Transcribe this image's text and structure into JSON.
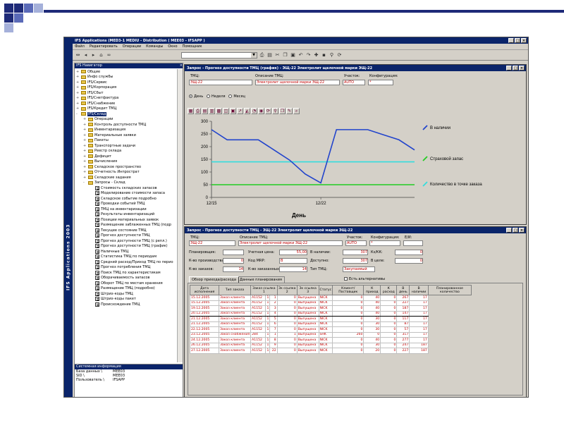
{
  "app": {
    "title": "IFS Applications (MED3-1 MEDIU - Distribution ( MEE03 - IFSAPP )",
    "brand": "IFS Applications 2003",
    "menu": [
      "Файл",
      "Редактировать",
      "Операции",
      "Команды",
      "Окно",
      "Помощник"
    ]
  },
  "navigator": {
    "title": "IFS Навигатор",
    "items": [
      {
        "label": "Общие",
        "level": 0,
        "type": "folder",
        "pm": "+"
      },
      {
        "label": "Инфо службы",
        "level": 0,
        "type": "folder",
        "pm": "+"
      },
      {
        "label": "IFS/Сервис",
        "level": 0,
        "type": "folder",
        "pm": "+"
      },
      {
        "label": "IFS/Корпорация",
        "level": 0,
        "type": "folder",
        "pm": "+"
      },
      {
        "label": "IFS/Сбыт",
        "level": 0,
        "type": "folder",
        "pm": "+"
      },
      {
        "label": "IFS/Снетфактура",
        "level": 0,
        "type": "folder",
        "pm": "+"
      },
      {
        "label": "IFS/Снабжение",
        "level": 0,
        "type": "folder",
        "pm": "+"
      },
      {
        "label": "IFS/Кредит ТМЦ",
        "level": 0,
        "type": "folder",
        "pm": "+"
      },
      {
        "label": "IFS/Склад",
        "level": 0,
        "type": "folder",
        "pm": "-",
        "selected": true
      },
      {
        "label": "Операции",
        "level": 1,
        "type": "folder",
        "pm": "+"
      },
      {
        "label": "Контроль доступности ТМЦ",
        "level": 1,
        "type": "folder",
        "pm": "+"
      },
      {
        "label": "Инвентаризация",
        "level": 1,
        "type": "folder",
        "pm": "+"
      },
      {
        "label": "Материальные заявки",
        "level": 1,
        "type": "folder",
        "pm": "+"
      },
      {
        "label": "Пакеты",
        "level": 1,
        "type": "folder",
        "pm": "+"
      },
      {
        "label": "Транспортные задачи",
        "level": 1,
        "type": "folder",
        "pm": "+"
      },
      {
        "label": "Реестр склада",
        "level": 1,
        "type": "folder",
        "pm": "+"
      },
      {
        "label": "Дефицит",
        "level": 1,
        "type": "folder",
        "pm": "+"
      },
      {
        "label": "Вычисления",
        "level": 1,
        "type": "folder",
        "pm": "+"
      },
      {
        "label": "Складское пространство",
        "level": 1,
        "type": "folder",
        "pm": "+"
      },
      {
        "label": "Отчетность Инпрострат",
        "level": 1,
        "type": "folder",
        "pm": "+"
      },
      {
        "label": "Складские задания",
        "level": 1,
        "type": "folder",
        "pm": "+"
      },
      {
        "label": "Запросы - Склад",
        "level": 1,
        "type": "folder",
        "pm": "-"
      },
      {
        "label": "Стоимость складских запасов",
        "level": 2,
        "type": "doc"
      },
      {
        "label": "Моделирование стоимости запаса",
        "level": 2,
        "type": "doc"
      },
      {
        "label": "Складское событие подробно",
        "level": 2,
        "type": "doc"
      },
      {
        "label": "Проводки событий ТМЦ",
        "level": 2,
        "type": "doc"
      },
      {
        "label": "ТМЦ на инвентаризации",
        "level": 2,
        "type": "doc"
      },
      {
        "label": "Результаты инвентаризаций",
        "level": 2,
        "type": "doc"
      },
      {
        "label": "Позиции материальных заявок",
        "level": 2,
        "type": "doc"
      },
      {
        "label": "Размещение заблаженных ТМЦ (подр",
        "level": 2,
        "type": "doc"
      },
      {
        "label": "Текущее состояние ТМЦ",
        "level": 2,
        "type": "doc"
      },
      {
        "label": "Прогноз доступности ТМЦ",
        "level": 2,
        "type": "doc"
      },
      {
        "label": "Прогноз доступности ТМЦ (с репл.)",
        "level": 2,
        "type": "doc"
      },
      {
        "label": "Прогноз доступности ТМЦ (график)",
        "level": 2,
        "type": "doc"
      },
      {
        "label": "Наличные ТМЦ",
        "level": 2,
        "type": "doc"
      },
      {
        "label": "Статистика ТМЦ по периодам",
        "level": 2,
        "type": "doc"
      },
      {
        "label": "Средний расход/Приход ТМЦ по перио",
        "level": 2,
        "type": "doc"
      },
      {
        "label": "Прогноз потребления ТМЦ",
        "level": 2,
        "type": "doc"
      },
      {
        "label": "Поиск ТМЦ по характеристикам",
        "level": 2,
        "type": "doc"
      },
      {
        "label": "Оборачиваемость запасов",
        "level": 2,
        "type": "doc"
      },
      {
        "label": "Оборот ТМЦ по местам хранения",
        "level": 2,
        "type": "doc"
      },
      {
        "label": "Размещение ТМЦ (подробно)",
        "level": 2,
        "type": "doc"
      },
      {
        "label": "Штрих-коды ТМЦ",
        "level": 2,
        "type": "doc"
      },
      {
        "label": "Штрих-коды пакет",
        "level": 2,
        "type": "doc"
      },
      {
        "label": "Происхождение ТМЦ",
        "level": 2,
        "type": "doc"
      }
    ],
    "info": {
      "title": "Системная информация",
      "rows": [
        {
          "k": "База данных \\",
          "v": "MEE03"
        },
        {
          "k": "SID \\",
          "v": "MEE03"
        },
        {
          "k": "Пользователь \\",
          "v": "IFSAPP"
        }
      ]
    }
  },
  "graph_window": {
    "title": "Запрос - Прогноз доступности ТМЦ (график) - ЭЩ-22 Электролит щелочной марки ЭЩ-22",
    "labels": {
      "tmc": "ТМЦ:",
      "desc": "Описание ТМЦ:",
      "site": "Участок:",
      "config": "Конфигурация:"
    },
    "values": {
      "tmc": "ЭЩ-22",
      "desc": "Электролит щелочной марки ЭЩ-22",
      "site": "AUTO",
      "config": "*"
    },
    "radios": [
      {
        "label": "День",
        "checked": true
      },
      {
        "label": "Неделя",
        "checked": false
      },
      {
        "label": "Месяц",
        "checked": false
      }
    ]
  },
  "chart_data": {
    "type": "line",
    "x": [
      "12/15",
      "12/16",
      "12/17",
      "12/18",
      "12/19",
      "12/20",
      "12/21",
      "12/22",
      "12/23",
      "12/24",
      "12/25",
      "12/26",
      "12/27"
    ],
    "tick_labels": [
      "12/15",
      "12/22"
    ],
    "xlabel": "День",
    "ylim": [
      0,
      300
    ],
    "yticks": [
      0,
      50,
      100,
      150,
      200,
      250,
      300
    ],
    "series": [
      {
        "name": "В наличии",
        "color": "#2244cc",
        "values": [
          267,
          227,
          227,
          227,
          187,
          147,
          92,
          57,
          267,
          267,
          267,
          247,
          227,
          187
        ]
      },
      {
        "name": "Страховой запас",
        "color": "#22cc22",
        "values": [
          50,
          50,
          50,
          50,
          50,
          50,
          50,
          50,
          50,
          50,
          50,
          50,
          50,
          50
        ]
      },
      {
        "name": "Количество в точке заказа",
        "color": "#33dddd",
        "values": [
          140,
          140,
          140,
          140,
          140,
          140,
          140,
          140,
          140,
          140,
          140,
          140,
          140,
          140
        ]
      }
    ],
    "legend": "right",
    "grid": false
  },
  "forecast_window": {
    "title": "Запрос - Прогноз доступности ТМЦ - ЭЩ-22 Электролит щелочной марки ЭЩ-22",
    "labels": {
      "tmc": "ТМЦ:",
      "desc": "Описание ТМЦ:",
      "site": "Участок:",
      "config": "Конфигурация:",
      "ei": "Е/И:",
      "planner": "Планировщик:",
      "unit_cost": "Учетная цена:",
      "on_hand": "В наличии:",
      "abc": "Кз/КК:",
      "prod_qty": "К-во производства:",
      "mrp": "Код MRP:",
      "available": "Доступно:",
      "in_orders": "В целе:",
      "order_qty": "К-во заказов:",
      "ordered_qty": "К-во заказанных:",
      "type": "Тип ТМЦ:",
      "alternatives": "Есть альтернативы"
    },
    "values": {
      "tmc": "ЭЩ-22",
      "desc": "Электролит щелочной марки ЭЩ-22",
      "site": "AUTO",
      "config": "*",
      "ei": "",
      "planner": "",
      "unit_cost": "55,00",
      "on_hand": "307",
      "abc": "0",
      "prod_qty": "0",
      "mrp": "B",
      "available": "307",
      "in_orders": "0",
      "order_qty": "14",
      "ordered_qty": "14",
      "type": "Закупаемый"
    },
    "tabs": [
      "Обзор прихода/расхода",
      "Данные планирования"
    ],
    "columns": [
      "Дата исполнения",
      "Тип заказа",
      "Заказ ссылка 1",
      "Зк ссылка 2",
      "Зк ссылка 3",
      "Статус",
      "Клиент/ Поставщик",
      "К приход",
      "К расход",
      "В день",
      "В наличии",
      "Планированное количество"
    ],
    "rows": [
      [
        "15.12.2005",
        "Заказ клиента",
        "A1152",
        "1",
        "1",
        "0",
        "Выпущена",
        "NICK",
        "0",
        "40",
        "0",
        "267",
        "17"
      ],
      [
        "15.12.2005",
        "Заказ клиента",
        "A1152",
        "1",
        "2",
        "0",
        "Выпущена",
        "NICK",
        "0",
        "40",
        "0",
        "227",
        "17"
      ],
      [
        "19.12.2005",
        "Заказ клиента",
        "A1152",
        "1",
        "3",
        "0",
        "Выпущена",
        "NICK",
        "0",
        "40",
        "0",
        "187",
        "17"
      ],
      [
        "20.12.2005",
        "Заказ клиента",
        "A1152",
        "1",
        "4",
        "0",
        "Выпущена",
        "NICK",
        "0",
        "40",
        "0",
        "147",
        "17"
      ],
      [
        "21.12.2005",
        "Заказ клиента",
        "A1152",
        "1",
        "5",
        "0",
        "Выпущена",
        "NICK",
        "0",
        "30",
        "0",
        "117",
        "17"
      ],
      [
        "21.12.2005",
        "Заказ клиента",
        "A1152",
        "1",
        "6",
        "0",
        "Выпущена",
        "NICK",
        "0",
        "30",
        "0",
        "87",
        "17"
      ],
      [
        "22.12.2005",
        "Заказ клиента",
        "A1152",
        "1",
        "7",
        "0",
        "Выпущена",
        "NICK",
        "0",
        "30",
        "0",
        "57",
        "17"
      ],
      [
        "23.12.2005",
        "Заказ снабжения",
        "284",
        "1",
        "1",
        "1",
        "Выпущена",
        "SHK",
        "260",
        "0",
        "0",
        "317",
        "17"
      ],
      [
        "24.12.2005",
        "Заказ клиента",
        "A1152",
        "1",
        "8",
        "0",
        "Выпущена",
        "NICK",
        "0",
        "40",
        "0",
        "277",
        "17"
      ],
      [
        "26.12.2005",
        "Заказ клиента",
        "A1152",
        "1",
        "9",
        "0",
        "Выпущена",
        "NICK",
        "0",
        "30",
        "0",
        "247",
        "187"
      ],
      [
        "27.12.2005",
        "Заказ клиента",
        "A1152",
        "1",
        "22",
        "0",
        "Выпущена",
        "NICK",
        "0",
        "20",
        "0",
        "227",
        "187"
      ]
    ]
  }
}
